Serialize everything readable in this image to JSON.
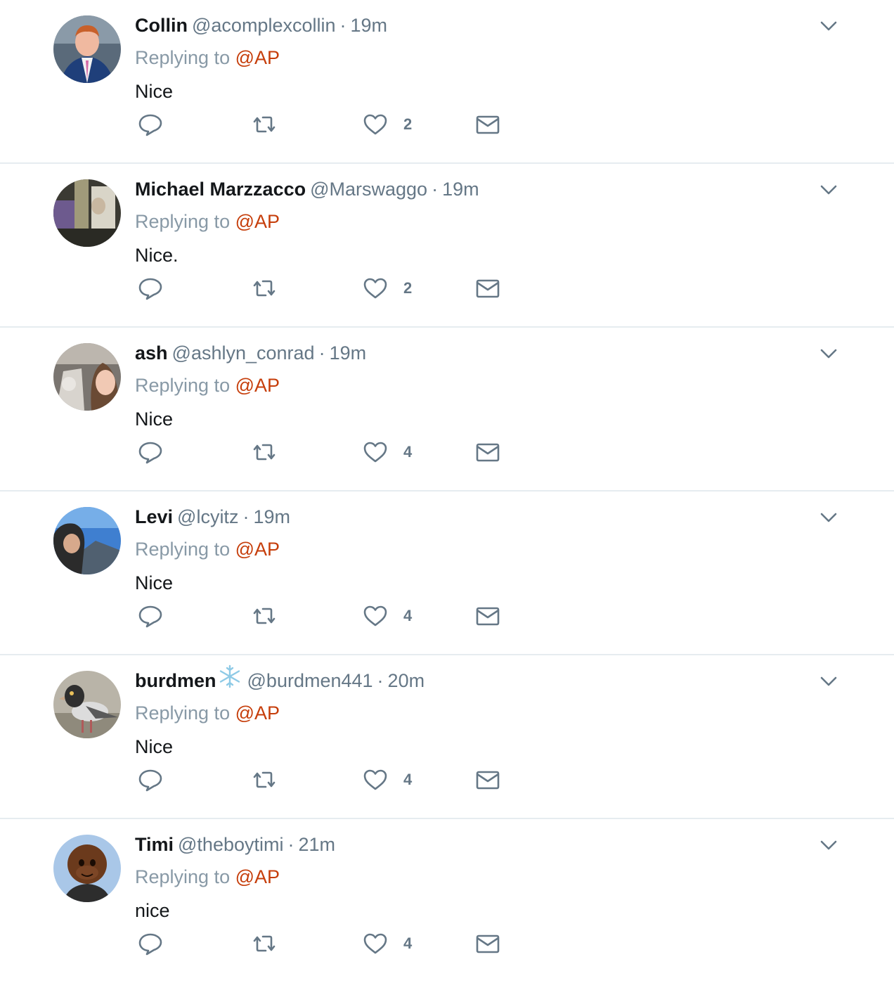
{
  "colors": {
    "accent_mention": "#c63e0b",
    "secondary_text": "#657786",
    "icon": "#657786",
    "divider": "#e6ecf0",
    "snowflake": "#8ecae6"
  },
  "replying_prefix": "Replying to",
  "tweets": [
    {
      "name": "Collin",
      "handle": "@acomplexcollin",
      "separator": "·",
      "time": "19m",
      "reply_to": "@AP",
      "text": "Nice",
      "likes": "2",
      "badge": "",
      "avatar_style": "suited-man"
    },
    {
      "name": "Michael Marzzacco",
      "handle": "@Marswaggo",
      "separator": "·",
      "time": "19m",
      "reply_to": "@AP",
      "text": "Nice.",
      "likes": "2",
      "badge": "",
      "avatar_style": "dim-room"
    },
    {
      "name": "ash",
      "handle": "@ashlyn_conrad",
      "separator": "·",
      "time": "19m",
      "reply_to": "@AP",
      "text": "Nice",
      "likes": "4",
      "badge": "",
      "avatar_style": "selfie-car"
    },
    {
      "name": "Levi",
      "handle": "@lcyitz",
      "separator": "·",
      "time": "19m",
      "reply_to": "@AP",
      "text": "Nice",
      "likes": "4",
      "badge": "",
      "avatar_style": "mountain-selfie"
    },
    {
      "name": "burdmen",
      "handle": "@burdmen441",
      "separator": "·",
      "time": "20m",
      "reply_to": "@AP",
      "text": "Nice",
      "likes": "4",
      "badge": "snowflake-icon",
      "avatar_style": "pigeon"
    },
    {
      "name": "Timi",
      "handle": "@theboytimi",
      "separator": "·",
      "time": "21m",
      "reply_to": "@AP",
      "text": "nice",
      "likes": "4",
      "badge": "",
      "avatar_style": "cartoon-character"
    }
  ]
}
